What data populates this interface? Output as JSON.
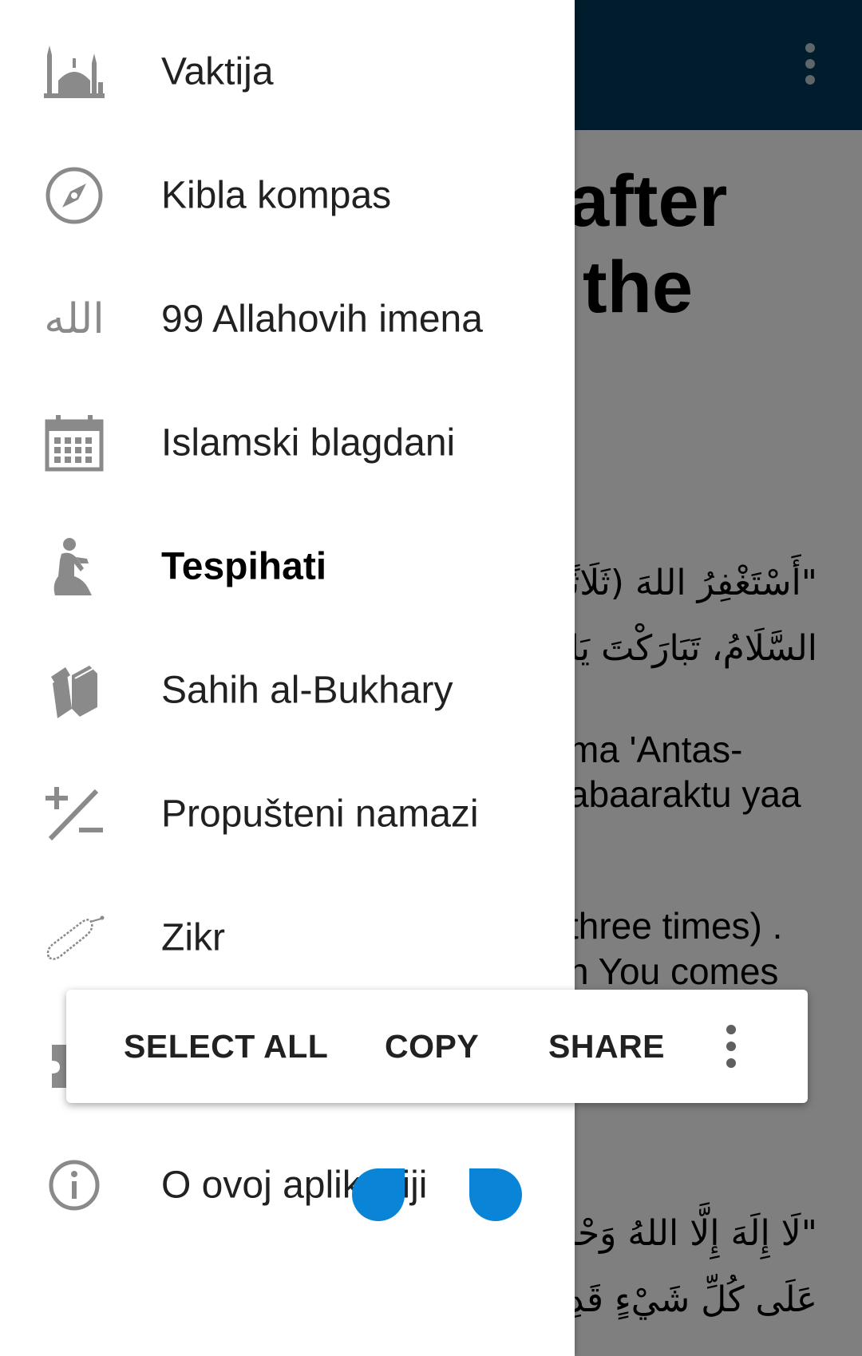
{
  "background": {
    "app_bar": {
      "menu_icon": "more-vert-icon",
      "color": "#00385a"
    },
    "title_lines": [
      "after",
      "the"
    ],
    "arabic_lines_top": [
      "\"أَسْتَغْفِرُ اللهَ (ثَلَاثًا)",
      "السَّلَامُ، تَبَارَكْتَ يَا ذَا"
    ],
    "transliteration_lines": [
      "ma 'Antas-",
      "abaaraktu yaa"
    ],
    "translation_lines": [
      "three times) .",
      "n You comes"
    ],
    "arabic_lines_bottom": [
      "\"لَا إِلَهَ إِلَّا اللهُ وَحْدَهُ",
      "عَلَى كُلِّ شَيْءٍ قَدِيرٌ"
    ]
  },
  "nav_drawer": {
    "items": [
      {
        "label": "Vaktija",
        "icon": "mosque-icon",
        "active": false
      },
      {
        "label": "Kibla kompas",
        "icon": "compass-icon",
        "active": false
      },
      {
        "label": "99 Allahovih imena",
        "icon": "allah-calligraphy-icon",
        "icon_text": "الله",
        "active": false
      },
      {
        "label": "Islamski blagdani",
        "icon": "calendar-icon",
        "active": false
      },
      {
        "label": "Tespihati",
        "icon": "praying-person-icon",
        "active": true
      },
      {
        "label": "Sahih al-Bukhary",
        "icon": "books-icon",
        "active": false
      },
      {
        "label": "Propušteni namazi",
        "icon": "plus-minus-icon",
        "active": false
      },
      {
        "label": "Zikr",
        "icon": "prayer-beads-icon",
        "active": false
      },
      {
        "label": "",
        "icon": "puzzle-icon",
        "active": false
      },
      {
        "label": "O ovoj aplikaciji",
        "icon": "info-icon",
        "active": false
      }
    ]
  },
  "selection_toolbar": {
    "select_all": "SELECT ALL",
    "copy": "COPY",
    "share": "SHARE",
    "more_icon": "more-vert-icon"
  },
  "colors": {
    "app_bar": "#00385a",
    "selection_handle": "#0a84d6",
    "icon_gray": "#8a8a8a"
  }
}
